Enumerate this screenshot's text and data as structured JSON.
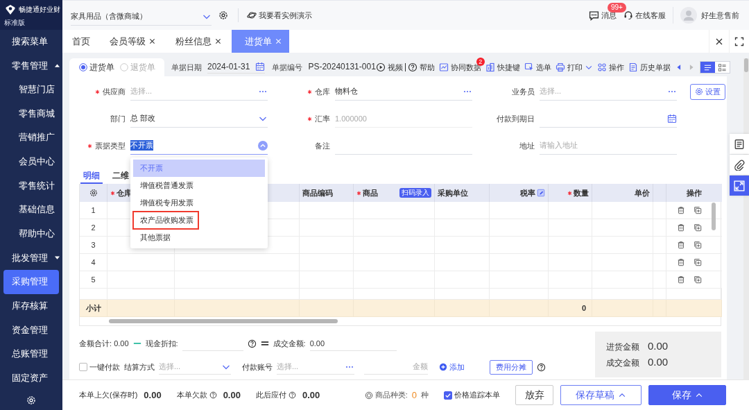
{
  "sidebar": {
    "logo": {
      "name": "畅捷通好业财",
      "edition": "标准版"
    },
    "items": [
      {
        "label": "搜索菜单",
        "selected": false
      },
      {
        "label": "零售管理",
        "selected": false,
        "expanded": true,
        "children": [
          {
            "label": "智慧门店",
            "selected": false
          },
          {
            "label": "零售商城",
            "selected": false
          },
          {
            "label": "营销推广",
            "selected": false
          },
          {
            "label": "会员中心",
            "selected": false
          },
          {
            "label": "零售统计",
            "selected": false
          },
          {
            "label": "基础信息",
            "selected": false
          },
          {
            "label": "帮助中心",
            "selected": false
          }
        ]
      },
      {
        "label": "批发管理",
        "selected": false,
        "expanded": false
      },
      {
        "label": "采购管理",
        "selected": true
      },
      {
        "label": "库存核算",
        "selected": false
      },
      {
        "label": "资金管理",
        "selected": false
      },
      {
        "label": "总账管理",
        "selected": false
      },
      {
        "label": "固定资产",
        "selected": false
      }
    ]
  },
  "topbar": {
    "store": "家具用品（含微商城）",
    "demo_link": "我要看实例演示",
    "messages": {
      "label": "消息",
      "badge": "99+"
    },
    "service": "在线客服",
    "user": "好生意售前"
  },
  "tabs": [
    {
      "label": "首页",
      "selected": false,
      "closable": false
    },
    {
      "label": "会员等级",
      "selected": false,
      "closable": true
    },
    {
      "label": "粉丝信息",
      "selected": false,
      "closable": true
    },
    {
      "label": "进货单",
      "selected": true,
      "closable": true
    }
  ],
  "doc_header": {
    "types": [
      {
        "label": "进货单",
        "selected": true
      },
      {
        "label": "退货单",
        "selected": false
      }
    ],
    "date_label": "单据日期",
    "date": "2024-01-31",
    "number_label": "单据编号",
    "number": "PS-20240131-001"
  },
  "toolbar": [
    {
      "label": "视频"
    },
    {
      "label": "帮助"
    },
    {
      "label": "协同数据",
      "badge": "2"
    },
    {
      "label": "快捷键"
    },
    {
      "label": "选单"
    },
    {
      "label": "打印",
      "dropdown": true
    },
    {
      "label": "操作"
    },
    {
      "label": "历史单据"
    }
  ],
  "view_modes": [
    {
      "kind": "list",
      "selected": true
    },
    {
      "kind": "detail",
      "selected": false
    }
  ],
  "form": {
    "settings_button": "设置",
    "fields": [
      {
        "kind": "lookup",
        "label": "供应商",
        "required": true,
        "placeholder": "选择...",
        "disabled": false
      },
      {
        "kind": "lookup",
        "label": "仓库",
        "required": true,
        "value": "物料仓",
        "disabled": false
      },
      {
        "kind": "lookup",
        "label": "业务员",
        "required": false,
        "placeholder": "选择...",
        "disabled": false
      },
      {
        "kind": "select",
        "label": "部门",
        "required": false,
        "value": "总 部改",
        "open": false,
        "disabled": false
      },
      {
        "kind": "text",
        "label": "汇率",
        "required": true,
        "value": "1.000000",
        "disabled": true
      },
      {
        "kind": "date",
        "label": "付款到期日",
        "required": false,
        "disabled": false
      },
      {
        "kind": "select",
        "label": "票据类型",
        "required": true,
        "value": "不开票",
        "text_selected": true,
        "open": true,
        "disabled": false
      },
      {
        "kind": "text",
        "label": "备注",
        "required": false,
        "disabled": false
      },
      {
        "kind": "text",
        "label": "地址",
        "required": false,
        "placeholder": "请输入地址",
        "disabled": false
      }
    ]
  },
  "invoice_dropdown": {
    "options": [
      {
        "label": "不开票",
        "selected": true,
        "marked": false
      },
      {
        "label": "增值税普通发票",
        "selected": false,
        "marked": false
      },
      {
        "label": "增值税专用发票",
        "selected": false,
        "marked": false
      },
      {
        "label": "农产品收购发票",
        "selected": false,
        "marked": true
      },
      {
        "label": "其他票据",
        "selected": false,
        "marked": false
      }
    ]
  },
  "detail_tabs": [
    {
      "label": "明细",
      "selected": true
    },
    {
      "label": "二维",
      "selected": false
    }
  ],
  "table": {
    "columns": [
      {
        "kind": "settings"
      },
      {
        "kind": "text",
        "label": "仓库",
        "required": true
      },
      {
        "kind": "blank"
      },
      {
        "kind": "text",
        "label": "商品编码",
        "required": false
      },
      {
        "kind": "text",
        "label": "商品",
        "required": true,
        "tag": "扫码录入"
      },
      {
        "kind": "text",
        "label": "采购单位",
        "required": false
      },
      {
        "kind": "text",
        "label": "税率",
        "required": false,
        "editable": true
      },
      {
        "kind": "text",
        "label": "数量",
        "required": true
      },
      {
        "kind": "text",
        "label": "单价",
        "required": false
      },
      {
        "kind": "blank"
      },
      {
        "kind": "actions",
        "label": "操作"
      }
    ],
    "rows": [
      "1",
      "2",
      "3",
      "4",
      "5"
    ],
    "subtotal": {
      "label": "小计",
      "quantity": "0"
    }
  },
  "summary": {
    "total_label": "金额合计:",
    "total": "0.00",
    "discount_label": "现金折扣:",
    "deal_label": "成交金额:",
    "deal": "0.00"
  },
  "payment": {
    "one_click": {
      "label": "一键付款",
      "checked": false
    },
    "method_label": "结算方式",
    "method_placeholder": "选择...",
    "account_label": "付款账号",
    "account_placeholder": "选择...",
    "amount_placeholder": "金额",
    "add": "添加",
    "split_button": "费用分摊"
  },
  "totals_box": [
    {
      "label": "进货金额",
      "value": "0.00"
    },
    {
      "label": "成交金额",
      "value": "0.00"
    }
  ],
  "footer": {
    "stats": [
      {
        "label": "本单上欠(保存时)",
        "value": "0.00",
        "help": false
      },
      {
        "label": "本单欠款",
        "value": "0.00",
        "help": true
      },
      {
        "label": "此后应付",
        "value": "0.00",
        "help": true
      }
    ],
    "kinds": {
      "label": "商品种类:",
      "count": "0",
      "unit": "种"
    },
    "track": {
      "label": "价格追踪本单",
      "checked": true
    },
    "buttons": [
      {
        "label": "放弃",
        "kind": "plain",
        "dropdown": false
      },
      {
        "label": "保存草稿",
        "kind": "outline",
        "dropdown": true
      },
      {
        "label": "保存",
        "kind": "primary",
        "dropdown": true
      }
    ]
  },
  "side_tools": [
    {
      "selected": false
    },
    {
      "selected": false
    },
    {
      "selected": true
    }
  ]
}
